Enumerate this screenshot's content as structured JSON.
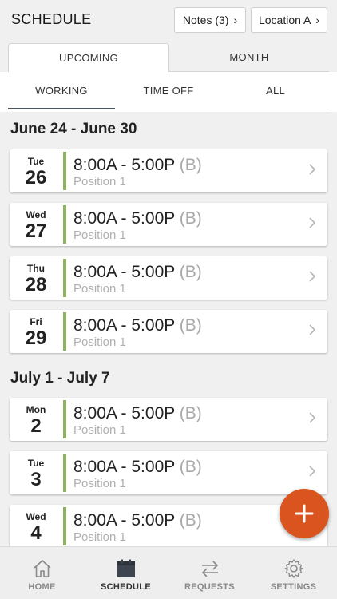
{
  "header": {
    "title": "SCHEDULE",
    "notes_label": "Notes (3)",
    "location_label": "Location A"
  },
  "tabs": [
    {
      "label": "UPCOMING",
      "active": true
    },
    {
      "label": "MONTH",
      "active": false
    }
  ],
  "subtabs": [
    {
      "label": "WORKING",
      "active": true
    },
    {
      "label": "TIME OFF",
      "active": false
    },
    {
      "label": "ALL",
      "active": false
    }
  ],
  "weeks": [
    {
      "heading": "June 24 - June 30",
      "shifts": [
        {
          "dow": "Tue",
          "day": "26",
          "time": "8:00A - 5:00P",
          "tag": "(B)",
          "position": "Position 1"
        },
        {
          "dow": "Wed",
          "day": "27",
          "time": "8:00A - 5:00P",
          "tag": "(B)",
          "position": "Position 1"
        },
        {
          "dow": "Thu",
          "day": "28",
          "time": "8:00A - 5:00P",
          "tag": "(B)",
          "position": "Position 1"
        },
        {
          "dow": "Fri",
          "day": "29",
          "time": "8:00A - 5:00P",
          "tag": "(B)",
          "position": "Position 1"
        }
      ]
    },
    {
      "heading": "July 1 - July 7",
      "shifts": [
        {
          "dow": "Mon",
          "day": "2",
          "time": "8:00A - 5:00P",
          "tag": "(B)",
          "position": "Position 1"
        },
        {
          "dow": "Tue",
          "day": "3",
          "time": "8:00A - 5:00P",
          "tag": "(B)",
          "position": "Position 1"
        },
        {
          "dow": "Wed",
          "day": "4",
          "time": "8:00A - 5:00P",
          "tag": "(B)",
          "position": "Position 1"
        }
      ]
    }
  ],
  "fab": {
    "icon": "plus-icon"
  },
  "nav": [
    {
      "label": "HOME",
      "icon": "home-icon",
      "active": false
    },
    {
      "label": "SCHEDULE",
      "icon": "calendar-icon",
      "active": true
    },
    {
      "label": "REQUESTS",
      "icon": "swap-arrows-icon",
      "active": false
    },
    {
      "label": "SETTINGS",
      "icon": "gear-icon",
      "active": false
    }
  ],
  "colors": {
    "accent_bar": "#8db35a",
    "fab": "#d9541e",
    "active_underline": "#4a5560"
  }
}
